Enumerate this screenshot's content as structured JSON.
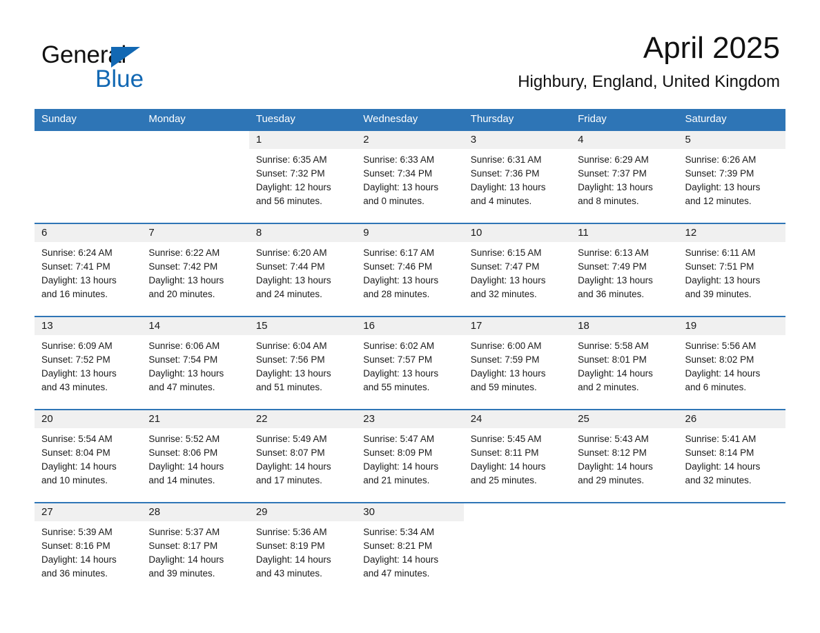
{
  "brand": {
    "word_general": "General",
    "word_blue": "Blue",
    "flag_icon": "triangle-flag-icon",
    "accent_color": "#1268B3"
  },
  "header": {
    "title": "April 2025",
    "location": "Highbury, England, United Kingdom"
  },
  "theme": {
    "header_bg": "#2E75B6",
    "daynum_bg": "#F0F0F0",
    "row_divider": "#2E75B6",
    "text": "#1a1a1a"
  },
  "calendar": {
    "weekday_headers": [
      "Sunday",
      "Monday",
      "Tuesday",
      "Wednesday",
      "Thursday",
      "Friday",
      "Saturday"
    ],
    "weeks": [
      [
        {
          "empty": true
        },
        {
          "empty": true
        },
        {
          "day": "1",
          "sunrise": "Sunrise: 6:35 AM",
          "sunset": "Sunset: 7:32 PM",
          "daylight_line1": "Daylight: 12 hours",
          "daylight_line2": "and 56 minutes."
        },
        {
          "day": "2",
          "sunrise": "Sunrise: 6:33 AM",
          "sunset": "Sunset: 7:34 PM",
          "daylight_line1": "Daylight: 13 hours",
          "daylight_line2": "and 0 minutes."
        },
        {
          "day": "3",
          "sunrise": "Sunrise: 6:31 AM",
          "sunset": "Sunset: 7:36 PM",
          "daylight_line1": "Daylight: 13 hours",
          "daylight_line2": "and 4 minutes."
        },
        {
          "day": "4",
          "sunrise": "Sunrise: 6:29 AM",
          "sunset": "Sunset: 7:37 PM",
          "daylight_line1": "Daylight: 13 hours",
          "daylight_line2": "and 8 minutes."
        },
        {
          "day": "5",
          "sunrise": "Sunrise: 6:26 AM",
          "sunset": "Sunset: 7:39 PM",
          "daylight_line1": "Daylight: 13 hours",
          "daylight_line2": "and 12 minutes."
        }
      ],
      [
        {
          "day": "6",
          "sunrise": "Sunrise: 6:24 AM",
          "sunset": "Sunset: 7:41 PM",
          "daylight_line1": "Daylight: 13 hours",
          "daylight_line2": "and 16 minutes."
        },
        {
          "day": "7",
          "sunrise": "Sunrise: 6:22 AM",
          "sunset": "Sunset: 7:42 PM",
          "daylight_line1": "Daylight: 13 hours",
          "daylight_line2": "and 20 minutes."
        },
        {
          "day": "8",
          "sunrise": "Sunrise: 6:20 AM",
          "sunset": "Sunset: 7:44 PM",
          "daylight_line1": "Daylight: 13 hours",
          "daylight_line2": "and 24 minutes."
        },
        {
          "day": "9",
          "sunrise": "Sunrise: 6:17 AM",
          "sunset": "Sunset: 7:46 PM",
          "daylight_line1": "Daylight: 13 hours",
          "daylight_line2": "and 28 minutes."
        },
        {
          "day": "10",
          "sunrise": "Sunrise: 6:15 AM",
          "sunset": "Sunset: 7:47 PM",
          "daylight_line1": "Daylight: 13 hours",
          "daylight_line2": "and 32 minutes."
        },
        {
          "day": "11",
          "sunrise": "Sunrise: 6:13 AM",
          "sunset": "Sunset: 7:49 PM",
          "daylight_line1": "Daylight: 13 hours",
          "daylight_line2": "and 36 minutes."
        },
        {
          "day": "12",
          "sunrise": "Sunrise: 6:11 AM",
          "sunset": "Sunset: 7:51 PM",
          "daylight_line1": "Daylight: 13 hours",
          "daylight_line2": "and 39 minutes."
        }
      ],
      [
        {
          "day": "13",
          "sunrise": "Sunrise: 6:09 AM",
          "sunset": "Sunset: 7:52 PM",
          "daylight_line1": "Daylight: 13 hours",
          "daylight_line2": "and 43 minutes."
        },
        {
          "day": "14",
          "sunrise": "Sunrise: 6:06 AM",
          "sunset": "Sunset: 7:54 PM",
          "daylight_line1": "Daylight: 13 hours",
          "daylight_line2": "and 47 minutes."
        },
        {
          "day": "15",
          "sunrise": "Sunrise: 6:04 AM",
          "sunset": "Sunset: 7:56 PM",
          "daylight_line1": "Daylight: 13 hours",
          "daylight_line2": "and 51 minutes."
        },
        {
          "day": "16",
          "sunrise": "Sunrise: 6:02 AM",
          "sunset": "Sunset: 7:57 PM",
          "daylight_line1": "Daylight: 13 hours",
          "daylight_line2": "and 55 minutes."
        },
        {
          "day": "17",
          "sunrise": "Sunrise: 6:00 AM",
          "sunset": "Sunset: 7:59 PM",
          "daylight_line1": "Daylight: 13 hours",
          "daylight_line2": "and 59 minutes."
        },
        {
          "day": "18",
          "sunrise": "Sunrise: 5:58 AM",
          "sunset": "Sunset: 8:01 PM",
          "daylight_line1": "Daylight: 14 hours",
          "daylight_line2": "and 2 minutes."
        },
        {
          "day": "19",
          "sunrise": "Sunrise: 5:56 AM",
          "sunset": "Sunset: 8:02 PM",
          "daylight_line1": "Daylight: 14 hours",
          "daylight_line2": "and 6 minutes."
        }
      ],
      [
        {
          "day": "20",
          "sunrise": "Sunrise: 5:54 AM",
          "sunset": "Sunset: 8:04 PM",
          "daylight_line1": "Daylight: 14 hours",
          "daylight_line2": "and 10 minutes."
        },
        {
          "day": "21",
          "sunrise": "Sunrise: 5:52 AM",
          "sunset": "Sunset: 8:06 PM",
          "daylight_line1": "Daylight: 14 hours",
          "daylight_line2": "and 14 minutes."
        },
        {
          "day": "22",
          "sunrise": "Sunrise: 5:49 AM",
          "sunset": "Sunset: 8:07 PM",
          "daylight_line1": "Daylight: 14 hours",
          "daylight_line2": "and 17 minutes."
        },
        {
          "day": "23",
          "sunrise": "Sunrise: 5:47 AM",
          "sunset": "Sunset: 8:09 PM",
          "daylight_line1": "Daylight: 14 hours",
          "daylight_line2": "and 21 minutes."
        },
        {
          "day": "24",
          "sunrise": "Sunrise: 5:45 AM",
          "sunset": "Sunset: 8:11 PM",
          "daylight_line1": "Daylight: 14 hours",
          "daylight_line2": "and 25 minutes."
        },
        {
          "day": "25",
          "sunrise": "Sunrise: 5:43 AM",
          "sunset": "Sunset: 8:12 PM",
          "daylight_line1": "Daylight: 14 hours",
          "daylight_line2": "and 29 minutes."
        },
        {
          "day": "26",
          "sunrise": "Sunrise: 5:41 AM",
          "sunset": "Sunset: 8:14 PM",
          "daylight_line1": "Daylight: 14 hours",
          "daylight_line2": "and 32 minutes."
        }
      ],
      [
        {
          "day": "27",
          "sunrise": "Sunrise: 5:39 AM",
          "sunset": "Sunset: 8:16 PM",
          "daylight_line1": "Daylight: 14 hours",
          "daylight_line2": "and 36 minutes."
        },
        {
          "day": "28",
          "sunrise": "Sunrise: 5:37 AM",
          "sunset": "Sunset: 8:17 PM",
          "daylight_line1": "Daylight: 14 hours",
          "daylight_line2": "and 39 minutes."
        },
        {
          "day": "29",
          "sunrise": "Sunrise: 5:36 AM",
          "sunset": "Sunset: 8:19 PM",
          "daylight_line1": "Daylight: 14 hours",
          "daylight_line2": "and 43 minutes."
        },
        {
          "day": "30",
          "sunrise": "Sunrise: 5:34 AM",
          "sunset": "Sunset: 8:21 PM",
          "daylight_line1": "Daylight: 14 hours",
          "daylight_line2": "and 47 minutes."
        },
        {
          "empty": true
        },
        {
          "empty": true
        },
        {
          "empty": true
        }
      ]
    ]
  }
}
